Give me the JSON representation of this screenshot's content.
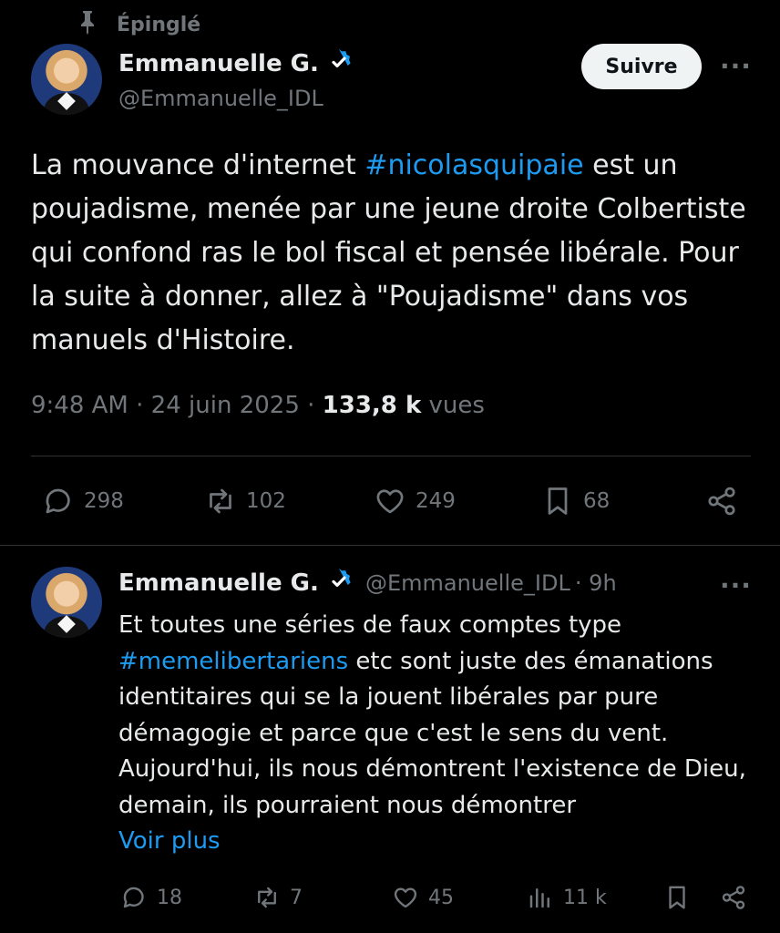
{
  "pinned": {
    "label": "Épinglé",
    "icon": "pin-icon"
  },
  "tweet": {
    "author_name": "Emmanuelle G.",
    "author_handle": "@Emmanuelle_IDL",
    "follow_label": "Suivre",
    "more_label": "···",
    "text_part1": "La mouvance d'internet ",
    "hashtag": "#nicolasquipaie",
    "text_part2": " est un poujadisme, menée par une jeune droite Colbertiste qui confond ras le bol fiscal et pensée libérale. Pour la suite à donner, allez à \"Poujadisme\" dans vos manuels d'Histoire.",
    "time": "9:48 AM",
    "date": "24 juin 2025",
    "sep": "·",
    "views_count": "133,8 k",
    "views_label": "vues",
    "actions": {
      "replies": "298",
      "reposts": "102",
      "likes": "249",
      "bookmarks": "68"
    }
  },
  "reply": {
    "author_name": "Emmanuelle G.",
    "author_handle": "@Emmanuelle_IDL",
    "time": "· 9h",
    "more_label": "···",
    "text_part1": "Et toutes une séries de faux comptes type ",
    "hashtag": "#memelibertariens",
    "text_part2": " etc sont juste des émanations identitaires qui se la jouent libérales par pure démagogie et parce que c'est le sens du vent. Aujourd'hui, ils nous démontrent l'existence de Dieu, demain, ils pourraient nous démontrer",
    "show_more": "Voir plus",
    "actions": {
      "replies": "18",
      "reposts": "7",
      "likes": "45",
      "views": "11 k"
    }
  },
  "colors": {
    "background": "#000000",
    "text": "#e7e9ea",
    "secondary": "#71767b",
    "accent": "#1d9bf0",
    "divider": "#2f3336"
  }
}
